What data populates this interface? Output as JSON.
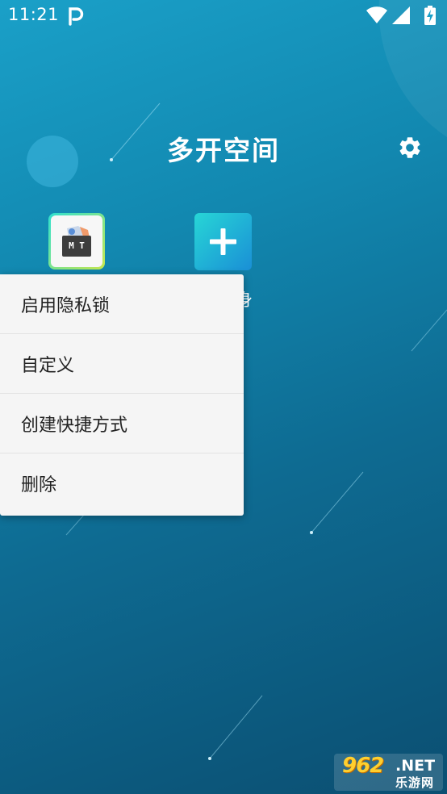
{
  "status_bar": {
    "time": "11:21",
    "notification_icon": "p-icon",
    "wifi_icon": "wifi-icon",
    "signal_icon": "signal-icon",
    "battery_icon": "battery-charging-icon"
  },
  "header": {
    "title": "多开空间",
    "settings_icon": "gear-icon"
  },
  "apps": [
    {
      "name": "mt-manager-app",
      "icon_text": "M T"
    }
  ],
  "add_app": {
    "icon": "plus-icon",
    "label_partial": "身"
  },
  "context_menu": {
    "items": [
      "启用隐私锁",
      "自定义",
      "创建快捷方式",
      "删除"
    ]
  },
  "watermark": {
    "number": "962",
    "suffix": ".NET",
    "text": "乐游网"
  },
  "colors": {
    "background_top": "#1aa0c8",
    "background_bottom": "#0b4f72",
    "menu_background": "#f5f5f5",
    "add_button": "#1a8fd6"
  }
}
